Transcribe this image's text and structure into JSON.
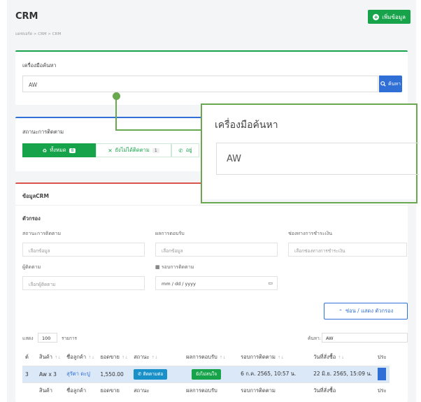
{
  "header": {
    "title": "CRM",
    "add_label": "เพิ่มข้อมูล"
  },
  "breadcrumb": "แดชบอร์ด  >  CRM  >  CRM",
  "search_card": {
    "title": "เครื่องมือค้นหา",
    "value": "AW",
    "button_label": "ค้นหา"
  },
  "status_card": {
    "title": "สถานะการติดตาม",
    "buttons": [
      {
        "label": "ทั้งหมด",
        "count": "8"
      },
      {
        "label": "ยังไม่ได้ติดตาม",
        "count": "1"
      },
      {
        "label": "อยู่"
      }
    ]
  },
  "data_card": {
    "title": "ข้อมูลCRM",
    "filter_heading": "ตัวกรอง",
    "filters": {
      "status_label": "สถานะการติดตาม",
      "status_ph": "เลือกข้อมูล",
      "response_label": "ผลการตอบรับ",
      "response_ph": "เลือกข้อมูล",
      "payment_label": "ช่องทางการชำระเงิน",
      "payment_ph": "เลือกช่องทางการชำระเงิน",
      "follower_label": "ผู้ติดตาม",
      "follower_ph": "เลือกผู้ติดตาม",
      "round_label": "รอบการติดตาม",
      "round_ph": "mm / dd / yyyy"
    },
    "toggle_label": "ซ่อน / แสดง ตัวกรอง",
    "show_label": "แสดง",
    "show_value": "100",
    "show_suffix": "รายการ",
    "search_label": "ค้นหา:",
    "search_value": "AW",
    "columns": [
      "ต์",
      "สินค้า",
      "ชื่อลูกค้า",
      "ยอดขาย",
      "สถานะ",
      "ผลการตอบรับ",
      "รอบการติดตาม",
      "วันที่สั่งซื้อ",
      "ประ"
    ],
    "row": {
      "no": "3",
      "product": "Aw x 3",
      "customer": "สุรัตา ดะปู",
      "sales": "1,550.00",
      "status_btn": "ติดตามต่อ",
      "response_btn": "ยังไม่สนใจ",
      "round": "6 ก.ค. 2565, 10:57 น.",
      "order_date": "22 มิ.ย. 2565, 15:09 น."
    },
    "footer": [
      "",
      "สินค้า",
      "ชื่อลูกค้า",
      "ยอดขาย",
      "สถานะ",
      "ผลการตอบรับ",
      "รอบการติดตาม",
      "วันที่สั่งซื้อ",
      "ประ"
    ]
  },
  "zoom_callout": {
    "title": "เครื่องมือค้นหา",
    "value": "AW"
  },
  "colors": {
    "green": "#17a34a",
    "blue": "#2f6fd6",
    "callout": "#6aa84f"
  }
}
